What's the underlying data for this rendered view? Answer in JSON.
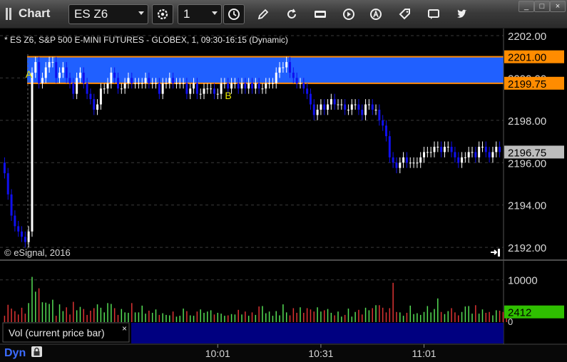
{
  "toolbar": {
    "title": "Chart",
    "symbol": "ES Z6",
    "interval": "1",
    "buttons": [
      "settings-icon",
      "clock-icon",
      "pencil-icon",
      "refresh-icon",
      "get-icon",
      "play-icon",
      "alert-icon",
      "tag-icon",
      "chat-icon",
      "twitter-icon"
    ],
    "window_buttons": [
      "_",
      "□",
      "×"
    ]
  },
  "colors": {
    "up": "#ffffff",
    "down": "#1010ee",
    "zone": "#2060ff",
    "zone_line": "#ff8a00",
    "vol_up": "#55dd55",
    "vol_down": "#dd3333",
    "axis_text": "#d8d8d8",
    "grid": "#3a3a3a",
    "label_bg": "#ff8c00",
    "current_bg": "#bdbdbd",
    "vol_label_bg": "#2fbf00"
  },
  "chart": {
    "header": "* ES Z6, S&P 500 E-MINI FUTURES - GLOBEX, 1, 09:30-16:15 (Dynamic)",
    "copyright": "© eSignal, 2016",
    "price_ticks": [
      "2202.00",
      "2200.00",
      "2198.00",
      "2196.00",
      "2194.00",
      "2192.00"
    ],
    "price_labels": {
      "upper": "2201.00",
      "lower": "2199.75",
      "current": "2196.75"
    },
    "markers": [
      "A",
      "B"
    ],
    "time_ticks": [
      "10:01",
      "10:31",
      "11:01"
    ],
    "bottom_left": "Dyn",
    "vol_ticks": [
      "10000",
      "0"
    ],
    "vol_current": "2412",
    "study_label": "Vol (current price bar)",
    "close_icon": "×"
  },
  "chart_data": {
    "type": "candlestick",
    "title": "ES Z6, S&P 500 E-MINI FUTURES - GLOBEX, 1, 09:30-16:15 (Dynamic)",
    "ylim": [
      2191.5,
      2202.2
    ],
    "zone": {
      "upper": 2201.0,
      "lower": 2199.75
    },
    "markers": [
      {
        "label": "A",
        "bar": 9
      },
      {
        "label": "B",
        "bar": 67
      }
    ],
    "time_labels": [
      {
        "bar": 62,
        "label": "10:01"
      },
      {
        "bar": 92,
        "label": "10:31"
      },
      {
        "bar": 122,
        "label": "11:01"
      }
    ],
    "vol_scale": {
      "max": 14000,
      "tick": 10000
    },
    "close": [
      2195.5,
      2194.5,
      2193.5,
      2193.0,
      2192.75,
      2192.5,
      2192.25,
      2192.75,
      2200.25,
      2200.75,
      2199.75,
      2200.0,
      2200.5,
      2200.75,
      2200.75,
      2200.0,
      2200.25,
      2200.5,
      2200.0,
      2199.75,
      2199.25,
      2200.0,
      2200.25,
      2199.75,
      2199.25,
      2199.0,
      2198.5,
      2198.75,
      2199.5,
      2199.5,
      2199.75,
      2200.25,
      2200.0,
      2199.5,
      2199.5,
      2199.75,
      2200.0,
      2199.75,
      2199.75,
      2199.75,
      2199.75,
      2200.0,
      2199.75,
      2199.75,
      2199.75,
      2199.25,
      2199.75,
      2199.75,
      2200.0,
      2199.75,
      2199.75,
      2199.75,
      2199.75,
      2199.25,
      2199.5,
      2199.75,
      2199.25,
      2199.25,
      2199.5,
      2199.5,
      2199.5,
      2199.25,
      2199.25,
      2199.75,
      2199.75,
      2199.5,
      2199.75,
      2199.75,
      2199.5,
      2199.75,
      2199.5,
      2199.75,
      2199.5,
      2199.75,
      2199.5,
      2199.5,
      2199.75,
      2199.75,
      2199.75,
      2200.25,
      2200.5,
      2200.5,
      2200.75,
      2200.25,
      2200.0,
      2199.75,
      2199.75,
      2199.5,
      2199.25,
      2198.75,
      2198.25,
      2198.5,
      2198.75,
      2198.5,
      2198.75,
      2199.0,
      2198.75,
      2198.75,
      2198.75,
      2198.5,
      2198.5,
      2198.75,
      2198.75,
      2198.5,
      2198.25,
      2198.75,
      2198.75,
      2198.5,
      2198.5,
      2198.0,
      2197.75,
      2197.25,
      2196.25,
      2196.0,
      2195.75,
      2196.0,
      2196.25,
      2196.0,
      2196.0,
      2196.0,
      2196.0,
      2196.25,
      2196.5,
      2196.5,
      2196.5,
      2196.75,
      2196.75,
      2196.5,
      2196.75,
      2196.75,
      2196.5,
      2196.25,
      2196.0,
      2196.25,
      2196.25,
      2196.5,
      2196.5,
      2196.25,
      2196.75,
      2196.75,
      2196.5,
      2196.25,
      2196.5,
      2196.75,
      2196.5
    ],
    "volume": [
      1500,
      4100,
      3200,
      2600,
      1800,
      3400,
      2000,
      4500,
      10700,
      7200,
      8000,
      4700,
      4600,
      4300,
      5300,
      1500,
      4200,
      2600,
      3500,
      1800,
      4800,
      2800,
      3600,
      3100,
      1700,
      2700,
      3300,
      4200,
      3400,
      2300,
      4500,
      4300,
      3300,
      1700,
      3100,
      2300,
      2200,
      4500,
      2300,
      2300,
      3900,
      2000,
      2700,
      2200,
      3000,
      1700,
      2100,
      1700,
      1600,
      2500,
      1300,
      1500,
      3200,
      2600,
      1600,
      1500,
      2500,
      3000,
      2200,
      2500,
      2800,
      1800,
      2200,
      2000,
      1500,
      1600,
      1900,
      1800,
      2900,
      1800,
      2500,
      1500,
      2300,
      1700,
      3700,
      3800,
      2100,
      2500,
      1500,
      2600,
      1600,
      4200,
      2300,
      1600,
      3300,
      2200,
      3500,
      2200,
      3300,
      3000,
      2500,
      3500,
      2500,
      2800,
      3100,
      2200,
      1600,
      2500,
      1300,
      1700,
      3200,
      1300,
      2400,
      2900,
      1800,
      3400,
      2800,
      3300,
      4000,
      4000,
      3400,
      2300,
      3300,
      9300,
      2400,
      2300,
      1500,
      2200,
      3900,
      1900,
      2100,
      1700,
      2400,
      3800,
      2300,
      3100,
      5600,
      2400,
      1900,
      2600,
      3300,
      2300,
      1600,
      2400,
      3700,
      3800,
      2000,
      4000,
      2000,
      3000,
      2200,
      2400,
      1600,
      2800,
      2700,
      2400,
      1800
    ],
    "volume_current": 2412
  }
}
